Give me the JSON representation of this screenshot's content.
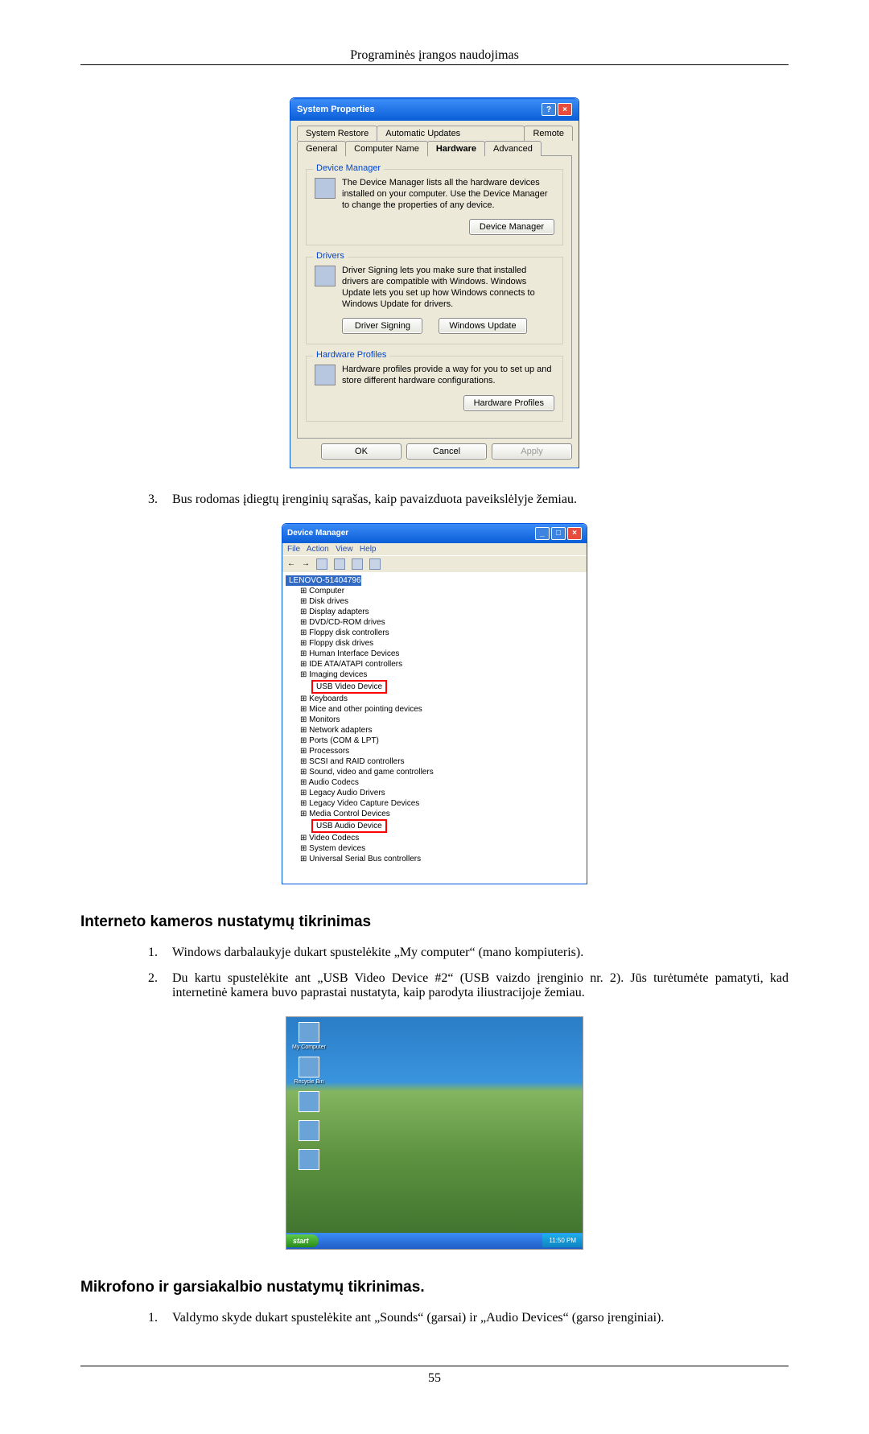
{
  "header": {
    "title": "Programinės įrangos naudojimas"
  },
  "sys_props": {
    "window_title": "System Properties",
    "tabs_row1": [
      "System Restore",
      "Automatic Updates",
      "Remote"
    ],
    "tabs_row2": [
      "General",
      "Computer Name",
      "Hardware",
      "Advanced"
    ],
    "active_tab": "Hardware",
    "groups": {
      "dm": {
        "legend": "Device Manager",
        "text": "The Device Manager lists all the hardware devices installed on your computer. Use the Device Manager to change the properties of any device.",
        "btn": "Device Manager"
      },
      "drv": {
        "legend": "Drivers",
        "text": "Driver Signing lets you make sure that installed drivers are compatible with Windows. Windows Update lets you set up how Windows connects to Windows Update for drivers.",
        "btn1": "Driver Signing",
        "btn2": "Windows Update"
      },
      "hp": {
        "legend": "Hardware Profiles",
        "text": "Hardware profiles provide a way for you to set up and store different hardware configurations.",
        "btn": "Hardware Profiles"
      }
    },
    "dialog_btns": {
      "ok": "OK",
      "cancel": "Cancel",
      "apply": "Apply"
    }
  },
  "step3": {
    "num": "3.",
    "text": "Bus rodomas įdiegtų įrenginių sąrašas, kaip pavaizduota paveikslėlyje žemiau."
  },
  "devmgr": {
    "title": "Device Manager",
    "menus": [
      "File",
      "Action",
      "View",
      "Help"
    ],
    "root": "LENOVO-51404796",
    "items": [
      "Computer",
      "Disk drives",
      "Display adapters",
      "DVD/CD-ROM drives",
      "Floppy disk controllers",
      "Floppy disk drives",
      "Human Interface Devices",
      "IDE ATA/ATAPI controllers",
      "Imaging devices"
    ],
    "highlight1": "USB Video Device",
    "items2": [
      "Keyboards",
      "Mice and other pointing devices",
      "Monitors",
      "Network adapters",
      "Ports (COM & LPT)",
      "Processors",
      "SCSI and RAID controllers",
      "Sound, video and game controllers",
      "Audio Codecs",
      "Legacy Audio Drivers",
      "Legacy Video Capture Devices",
      "Media Control Devices"
    ],
    "highlight2": "USB Audio Device",
    "items3": [
      "Video Codecs",
      "System devices",
      "Universal Serial Bus controllers"
    ]
  },
  "section_webcam": {
    "heading": "Interneto kameros nustatymų tikrinimas",
    "steps": [
      {
        "num": "1.",
        "text": "Windows darbalaukyje dukart spustelėkite „My computer“ (mano kompiuteris)."
      },
      {
        "num": "2.",
        "text": "Du kartu spustelėkite ant „USB Video Device #2“ (USB vaizdo įrenginio nr. 2). Jūs turėtumėte pamatyti, kad internetinė kamera buvo paprastai nustatyta, kaip parodyta iliustracijoje žemiau."
      }
    ]
  },
  "desktop": {
    "icons": [
      "My Computer",
      "Recycle Bin",
      "",
      "",
      ""
    ],
    "start": "start",
    "systray": "11:50 PM"
  },
  "section_mic": {
    "heading": "Mikrofono ir garsiakalbio nustatymų tikrinimas.",
    "steps": [
      {
        "num": "1.",
        "text": "Valdymo skyde dukart spustelėkite ant „Sounds“ (garsai) ir „Audio Devices“ (garso įrenginiai)."
      }
    ]
  },
  "footer": {
    "page": "55"
  }
}
